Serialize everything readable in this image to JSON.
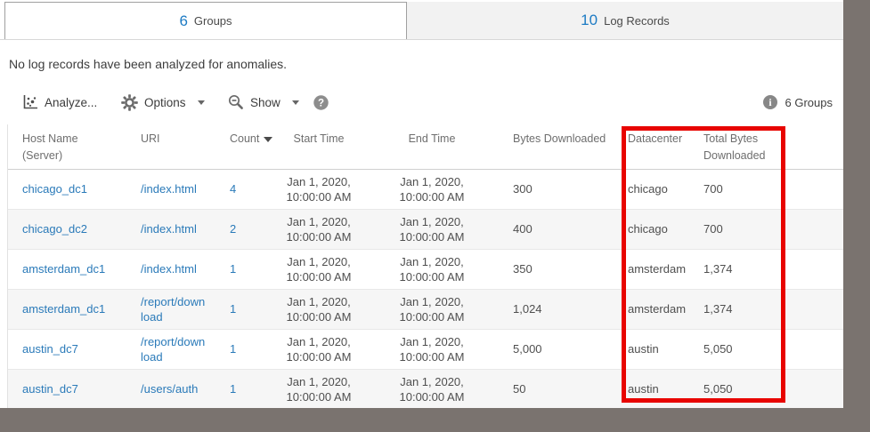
{
  "tabs": {
    "groups": {
      "count": "6",
      "label": "Groups"
    },
    "log_records": {
      "count": "10",
      "label": "Log Records"
    }
  },
  "message": "No log records have been analyzed for anomalies.",
  "toolbar": {
    "analyze_label": "Analyze...",
    "options_label": "Options",
    "show_label": "Show",
    "groups_summary": "6 Groups"
  },
  "table": {
    "columns": [
      {
        "line1": "Host Name",
        "line2": "(Server)"
      },
      {
        "line1": "URI"
      },
      {
        "line1": "Count",
        "sorted": "descending"
      },
      {
        "line1": "Start Time"
      },
      {
        "line1": "End Time"
      },
      {
        "line1": "Bytes Downloaded"
      },
      {
        "line1": "Datacenter"
      },
      {
        "line1": "Total Bytes",
        "line2": "Downloaded"
      }
    ],
    "rows": [
      {
        "host": "chicago_dc1",
        "uri": "/index.html",
        "count": "4",
        "start_date": "Jan 1, 2020,",
        "start_time": "10:00:00 AM",
        "end_date": "Jan 1, 2020,",
        "end_time": "10:00:00 AM",
        "bytes": "300",
        "datacenter": "chicago",
        "total_bytes": "700"
      },
      {
        "host": "chicago_dc2",
        "uri": "/index.html",
        "count": "2",
        "start_date": "Jan 1, 2020,",
        "start_time": "10:00:00 AM",
        "end_date": "Jan 1, 2020,",
        "end_time": "10:00:00 AM",
        "bytes": "400",
        "datacenter": "chicago",
        "total_bytes": "700"
      },
      {
        "host": "amsterdam_dc1",
        "uri": "/index.html",
        "count": "1",
        "start_date": "Jan 1, 2020,",
        "start_time": "10:00:00 AM",
        "end_date": "Jan 1, 2020,",
        "end_time": "10:00:00 AM",
        "bytes": "350",
        "datacenter": "amsterdam",
        "total_bytes": "1,374"
      },
      {
        "host": "amsterdam_dc1",
        "uri": "/report/download",
        "count": "1",
        "start_date": "Jan 1, 2020,",
        "start_time": "10:00:00 AM",
        "end_date": "Jan 1, 2020,",
        "end_time": "10:00:00 AM",
        "bytes": "1,024",
        "datacenter": "amsterdam",
        "total_bytes": "1,374"
      },
      {
        "host": "austin_dc7",
        "uri": "/report/download",
        "count": "1",
        "start_date": "Jan 1, 2020,",
        "start_time": "10:00:00 AM",
        "end_date": "Jan 1, 2020,",
        "end_time": "10:00:00 AM",
        "bytes": "5,000",
        "datacenter": "austin",
        "total_bytes": "5,050"
      },
      {
        "host": "austin_dc7",
        "uri": "/users/auth",
        "count": "1",
        "start_date": "Jan 1, 2020,",
        "start_time": "10:00:00 AM",
        "end_date": "Jan 1, 2020,",
        "end_time": "10:00:00 AM",
        "bytes": "50",
        "datacenter": "austin",
        "total_bytes": "5,050"
      }
    ]
  },
  "annotation": {
    "highlighted_columns": "Datacenter, Total Bytes Downloaded",
    "color": "#e80400"
  },
  "colors": {
    "link_blue": "#2a7ab9",
    "tab_number_blue": "#1d7bc4",
    "desktop_gray": "#7a736f",
    "stripe": "#f6f6f6"
  }
}
